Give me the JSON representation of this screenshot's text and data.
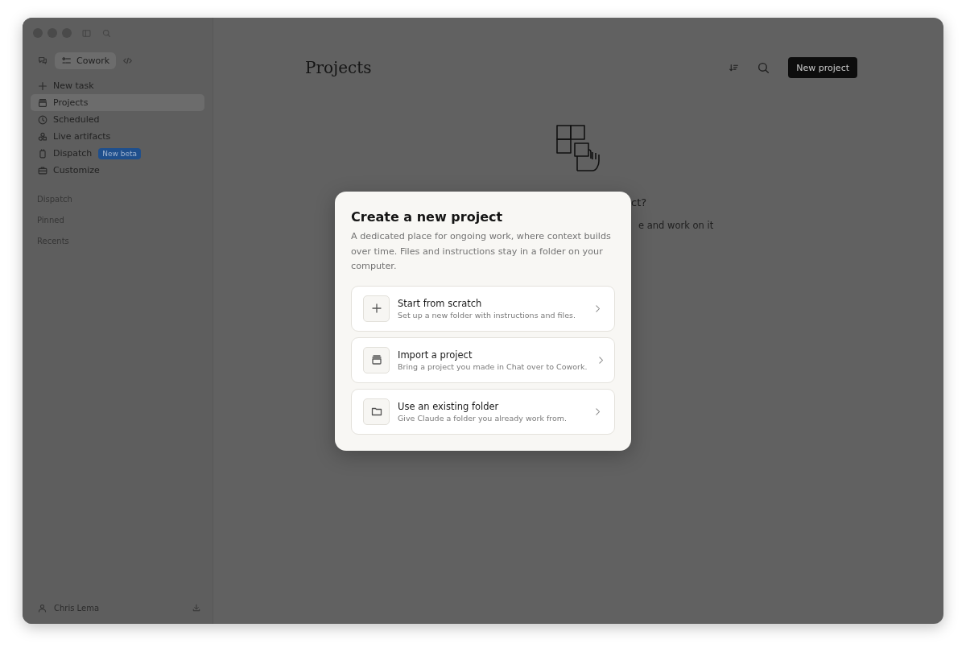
{
  "sidebar": {
    "mode_switch": {
      "label": "Cowork",
      "selected": true
    },
    "nav_items": [
      {
        "label": "New task",
        "selected": false
      },
      {
        "label": "Projects",
        "selected": true
      },
      {
        "label": "Scheduled",
        "selected": false
      },
      {
        "label": "Live artifacts",
        "selected": false
      },
      {
        "label": "Dispatch",
        "selected": false,
        "badge": "New beta"
      },
      {
        "label": "Customize",
        "selected": false
      }
    ],
    "sections": [
      "Dispatch",
      "Pinned",
      "Recents"
    ],
    "user": {
      "name": "Chris Lema"
    }
  },
  "main": {
    "title": "Projects",
    "new_button": "New project",
    "empty_state": {
      "heading_fragment": "ct?",
      "text_fragment": "e and work on it"
    }
  },
  "dialog": {
    "title": "Create a new project",
    "description": "A dedicated place for ongoing work, where context builds over time. Files and instructions stay in a folder on your computer.",
    "options": [
      {
        "title": "Start from scratch",
        "subtitle": "Set up a new folder with instructions and files."
      },
      {
        "title": "Import a project",
        "subtitle": "Bring a project you made in Chat over to Cowork."
      },
      {
        "title": "Use an existing folder",
        "subtitle": "Give Claude a folder you already work from."
      }
    ]
  }
}
